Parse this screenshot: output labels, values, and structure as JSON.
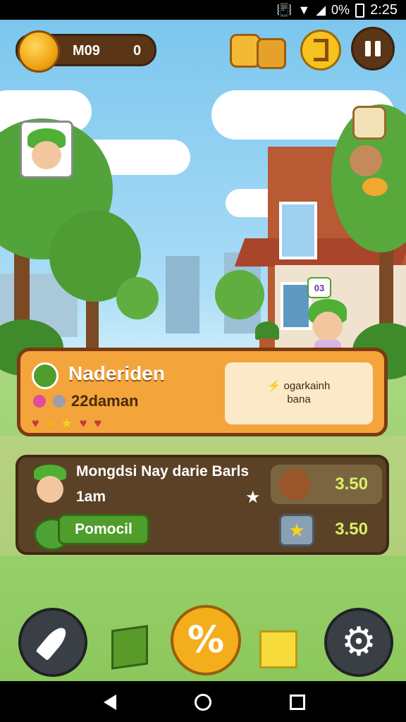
{
  "status_bar": {
    "battery": "0%",
    "time": "2:25"
  },
  "hud": {
    "coin_label": "M09",
    "coin_value": "0"
  },
  "location_card": {
    "title": "Naderiden",
    "subtitle": "22daman",
    "note_line1": "ogarkainh",
    "note_line2": "bana"
  },
  "offer_card": {
    "title": "Mongdsi Nay darie Barls",
    "time": "1am",
    "button_label": "Pomocil",
    "price_top": "3.50",
    "price_bottom": "3.50"
  },
  "character_badge": "03",
  "icons": {
    "coin": "coin-icon",
    "pause": "pause-icon",
    "settings": "gear-icon",
    "back": "back-icon",
    "home": "home-icon",
    "recents": "recents-icon"
  },
  "colors": {
    "card_orange": "#f3a43b",
    "card_brown": "#5b4226",
    "price_text": "#d9f06a"
  }
}
